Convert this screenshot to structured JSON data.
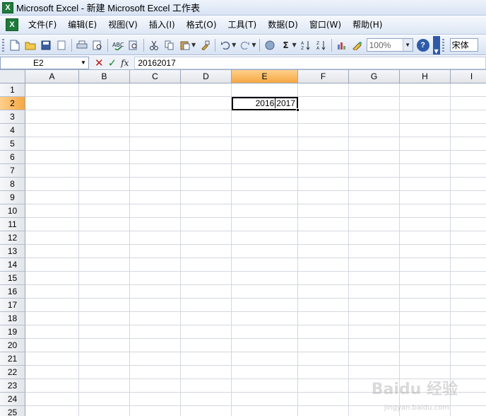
{
  "window": {
    "title": "Microsoft Excel - 新建 Microsoft Excel 工作表",
    "app_icon_glyph": "X"
  },
  "menu": {
    "items": [
      "文件(F)",
      "编辑(E)",
      "视图(V)",
      "插入(I)",
      "格式(O)",
      "工具(T)",
      "数据(D)",
      "窗口(W)",
      "帮助(H)"
    ]
  },
  "toolbar": {
    "zoom": "100%",
    "font": "宋体",
    "sum_glyph": "Σ",
    "help_glyph": "?"
  },
  "formula_bar": {
    "name_box": "E2",
    "cancel_glyph": "✕",
    "enter_glyph": "✓",
    "fx_label": "fx",
    "content": "20162017"
  },
  "sheet": {
    "columns": [
      "A",
      "B",
      "C",
      "D",
      "E",
      "F",
      "G",
      "H",
      "I"
    ],
    "rows": [
      "1",
      "2",
      "3",
      "4",
      "5",
      "6",
      "7",
      "8",
      "9",
      "10",
      "11",
      "12",
      "13",
      "14",
      "15",
      "16",
      "17",
      "18",
      "19",
      "20",
      "21",
      "22",
      "23",
      "24",
      "25"
    ],
    "active_cell": {
      "row": "2",
      "col": "E",
      "value_before_caret": "2016",
      "value_after_caret": "2017"
    }
  },
  "watermark": {
    "text": "Baidu 经验",
    "sub": "jingyan.baidu.com"
  }
}
